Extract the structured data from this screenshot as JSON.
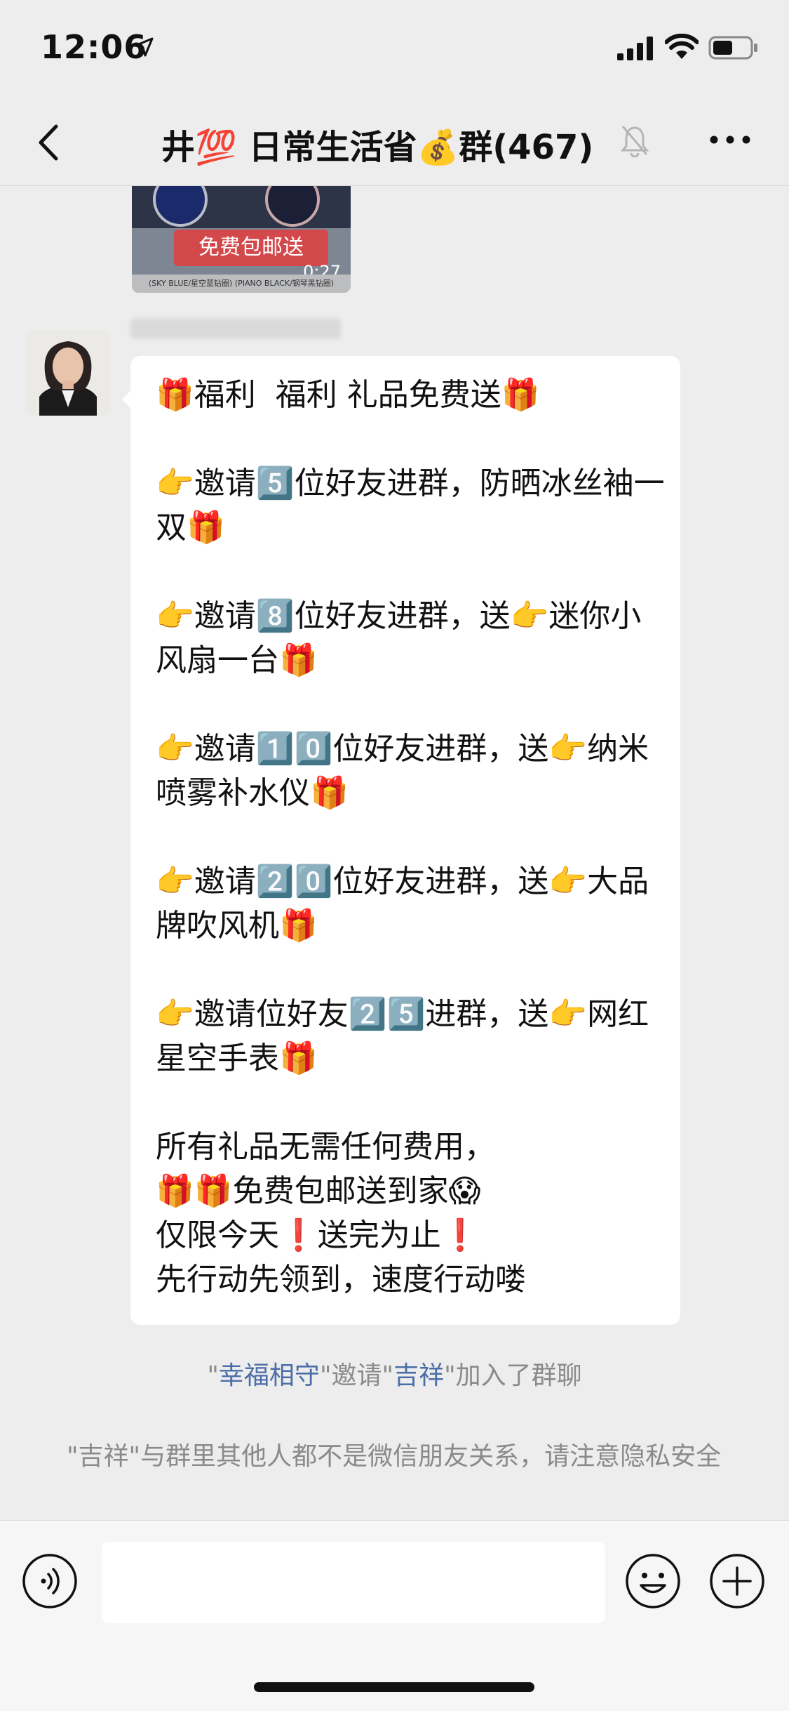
{
  "status_bar": {
    "time": "12:06"
  },
  "nav": {
    "title": "井💯 日常生活省💰群(467)"
  },
  "video": {
    "banner": "免费包邮送",
    "duration": "0:27",
    "caption": "(SKY BLUE/星空蓝钻圈)   (PIANO BLACK/钢琴黑钻圈)"
  },
  "message": {
    "text": "🎁福利  福利 礼品免费送🎁\n\n👉邀请5️⃣位好友进群，防晒冰丝袖一双🎁\n\n👉邀请8️⃣位好友进群，送👉迷你小风扇一台🎁\n\n👉邀请1️⃣0️⃣位好友进群，送👉纳米喷雾补水仪🎁\n\n👉邀请2️⃣0️⃣位好友进群，送👉大品牌吹风机🎁\n\n👉邀请位好友2️⃣5️⃣进群，送👉网红星空手表🎁\n\n所有礼品无需任何费用，\n🎁🎁免费包邮送到家😱\n仅限今天❗送完为止❗\n先行动先领到，速度行动喽"
  },
  "system": {
    "join_q1": "\"",
    "join_user1": "幸福相守",
    "join_mid": "\"邀请\"",
    "join_user2": "吉祥",
    "join_end": "\"加入了群聊",
    "privacy": "\"吉祥\"与群里其他人都不是微信朋友关系，请注意隐私安全"
  },
  "input": {
    "placeholder": ""
  }
}
